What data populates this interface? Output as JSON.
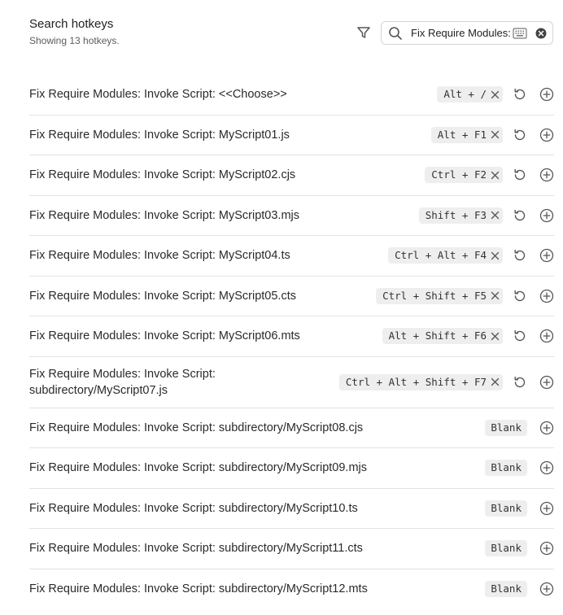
{
  "header": {
    "title": "Search hotkeys",
    "subtitle": "Showing 13 hotkeys."
  },
  "search": {
    "value": "Fix Require Modules:",
    "filter_icon": "filter-icon",
    "search_icon": "search-icon",
    "keyboard_icon": "keyboard-icon",
    "clear_icon": "clear-icon"
  },
  "hotkeys": [
    {
      "name": "Fix Require Modules: Invoke Script: <<Choose>>",
      "hotkey": "Alt + /",
      "blank_label": ""
    },
    {
      "name": "Fix Require Modules: Invoke Script: MyScript01.js",
      "hotkey": "Alt + F1",
      "blank_label": ""
    },
    {
      "name": "Fix Require Modules: Invoke Script: MyScript02.cjs",
      "hotkey": "Ctrl + F2",
      "blank_label": ""
    },
    {
      "name": "Fix Require Modules: Invoke Script: MyScript03.mjs",
      "hotkey": "Shift + F3",
      "blank_label": ""
    },
    {
      "name": "Fix Require Modules: Invoke Script: MyScript04.ts",
      "hotkey": "Ctrl + Alt + F4",
      "blank_label": ""
    },
    {
      "name": "Fix Require Modules: Invoke Script: MyScript05.cts",
      "hotkey": "Ctrl + Shift + F5",
      "blank_label": ""
    },
    {
      "name": "Fix Require Modules: Invoke Script: MyScript06.mts",
      "hotkey": "Alt + Shift + F6",
      "blank_label": ""
    },
    {
      "name": "Fix Require Modules: Invoke Script: subdirectory/MyScript07.js",
      "hotkey": "Ctrl + Alt + Shift + F7",
      "blank_label": ""
    },
    {
      "name": "Fix Require Modules: Invoke Script: subdirectory/MyScript08.cjs",
      "hotkey": "",
      "blank_label": "Blank"
    },
    {
      "name": "Fix Require Modules: Invoke Script: subdirectory/MyScript09.mjs",
      "hotkey": "",
      "blank_label": "Blank"
    },
    {
      "name": "Fix Require Modules: Invoke Script: subdirectory/MyScript10.ts",
      "hotkey": "",
      "blank_label": "Blank"
    },
    {
      "name": "Fix Require Modules: Invoke Script: subdirectory/MyScript11.cts",
      "hotkey": "",
      "blank_label": "Blank"
    },
    {
      "name": "Fix Require Modules: Invoke Script: subdirectory/MyScript12.mts",
      "hotkey": "",
      "blank_label": "Blank"
    }
  ]
}
